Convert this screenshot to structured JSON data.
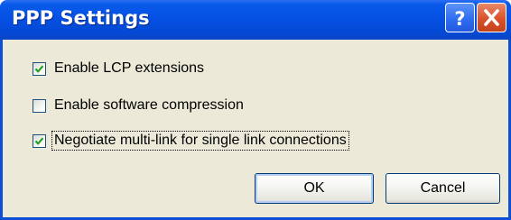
{
  "dialog": {
    "title": "PPP Settings",
    "help_button": "?",
    "close_icon": "close-icon"
  },
  "options": [
    {
      "label": "Enable LCP extensions",
      "checked": true
    },
    {
      "label": "Enable software compression",
      "checked": false
    },
    {
      "label": "Negotiate multi-link for single link connections",
      "checked": true
    }
  ],
  "buttons": {
    "ok": "OK",
    "cancel": "Cancel"
  },
  "colors": {
    "titlebar": "#0551e4",
    "frame": "#0a4fd6",
    "face": "#ece9d8",
    "close": "#d9522a",
    "check": "#21a121"
  }
}
